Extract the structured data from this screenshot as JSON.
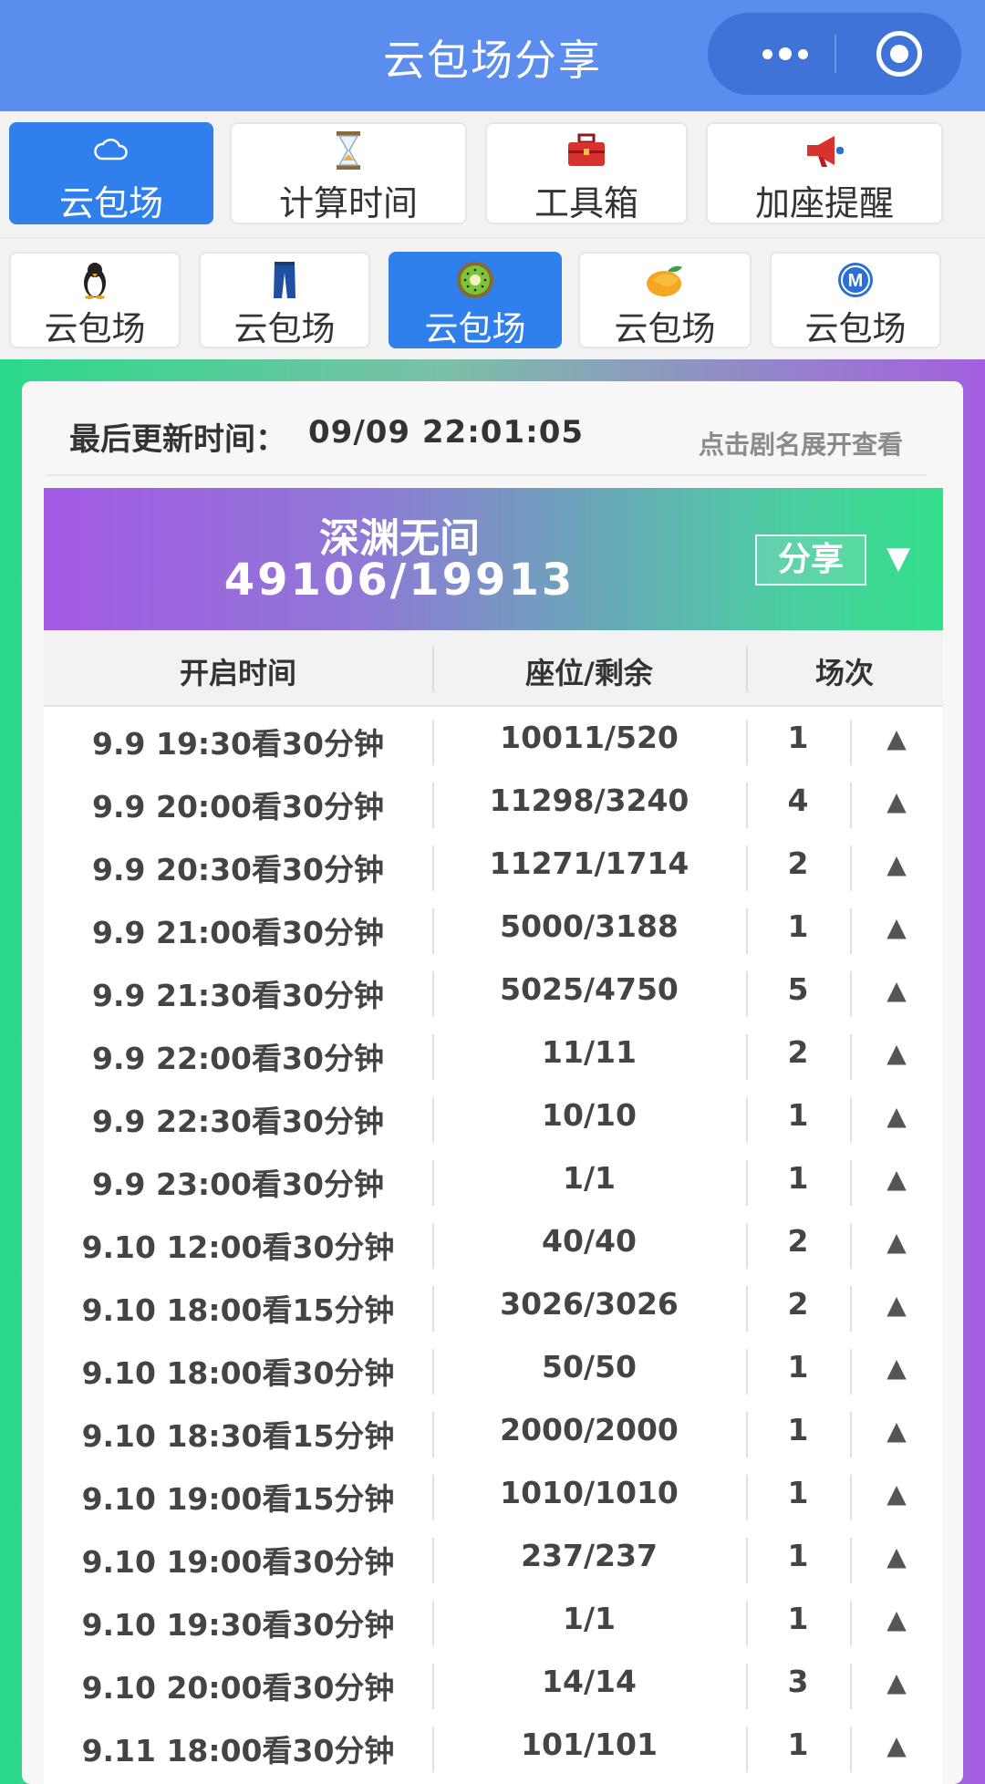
{
  "header": {
    "title": "云包场分享"
  },
  "main_tabs": [
    {
      "label": "云包场",
      "icon": "cloud-icon",
      "active": true
    },
    {
      "label": "计算时间",
      "icon": "hourglass-icon",
      "active": false
    },
    {
      "label": "工具箱",
      "icon": "toolbox-icon",
      "active": false
    },
    {
      "label": "加座提醒",
      "icon": "megaphone-icon",
      "active": false
    }
  ],
  "platform_tabs": [
    {
      "label": "云包场",
      "icon": "penguin-icon",
      "active": false
    },
    {
      "label": "云包场",
      "icon": "jeans-icon",
      "active": false
    },
    {
      "label": "云包场",
      "icon": "kiwi-icon",
      "active": true
    },
    {
      "label": "云包场",
      "icon": "mango-icon",
      "active": false
    },
    {
      "label": "云包场",
      "icon": "m-logo-icon",
      "active": false
    }
  ],
  "updated": {
    "label": "最后更新时间：",
    "time": "09/09 22:01:05"
  },
  "hint": "点击剧名展开查看",
  "show": {
    "name": "深渊无间",
    "count": "49106/19913",
    "share_label": "分享",
    "expand_glyph": "▼"
  },
  "table": {
    "headers": [
      "开启时间",
      "座位/剩余",
      "场次"
    ],
    "rows": [
      {
        "time": "9.9 19:30看30分钟",
        "seats": "10011/520",
        "count": "1"
      },
      {
        "time": "9.9 20:00看30分钟",
        "seats": "11298/3240",
        "count": "4"
      },
      {
        "time": "9.9 20:30看30分钟",
        "seats": "11271/1714",
        "count": "2"
      },
      {
        "time": "9.9 21:00看30分钟",
        "seats": "5000/3188",
        "count": "1"
      },
      {
        "time": "9.9 21:30看30分钟",
        "seats": "5025/4750",
        "count": "5"
      },
      {
        "time": "9.9 22:00看30分钟",
        "seats": "11/11",
        "count": "2"
      },
      {
        "time": "9.9 22:30看30分钟",
        "seats": "10/10",
        "count": "1"
      },
      {
        "time": "9.9 23:00看30分钟",
        "seats": "1/1",
        "count": "1"
      },
      {
        "time": "9.10 12:00看30分钟",
        "seats": "40/40",
        "count": "2"
      },
      {
        "time": "9.10 18:00看15分钟",
        "seats": "3026/3026",
        "count": "2"
      },
      {
        "time": "9.10 18:00看30分钟",
        "seats": "50/50",
        "count": "1"
      },
      {
        "time": "9.10 18:30看15分钟",
        "seats": "2000/2000",
        "count": "1"
      },
      {
        "time": "9.10 19:00看15分钟",
        "seats": "1010/1010",
        "count": "1"
      },
      {
        "time": "9.10 19:00看30分钟",
        "seats": "237/237",
        "count": "1"
      },
      {
        "time": "9.10 19:30看30分钟",
        "seats": "1/1",
        "count": "1"
      },
      {
        "time": "9.10 20:00看30分钟",
        "seats": "14/14",
        "count": "3"
      },
      {
        "time": "9.11 18:00看30分钟",
        "seats": "101/101",
        "count": "1"
      }
    ],
    "row_glyph": "▲"
  },
  "colors": {
    "header": "#5b8def",
    "active_tab": "#2f80ed"
  }
}
